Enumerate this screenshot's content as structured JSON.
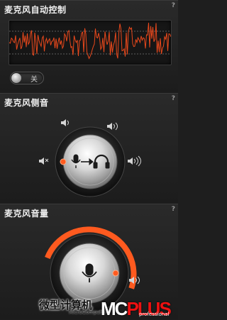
{
  "auto_control": {
    "title": "麦克风自动控制",
    "help": "?",
    "toggle_label": "关"
  },
  "sidetone": {
    "title": "麦克风侧音",
    "help": "?"
  },
  "volume": {
    "title": "麦克风音量",
    "help": "?",
    "level": 0.72
  },
  "watermark": {
    "text": "微型计算机",
    "sub": "MicroComputer",
    "logo_a": "MC",
    "logo_b": "PLUS",
    "logo_sub": "professional"
  },
  "colors": {
    "accent": "#ff5a1f",
    "wave": "#e8481c"
  },
  "icons": [
    "speaker-mute-icon",
    "speaker-low-icon",
    "speaker-mid-icon",
    "speaker-high-icon",
    "microphone-icon",
    "headphones-icon"
  ]
}
